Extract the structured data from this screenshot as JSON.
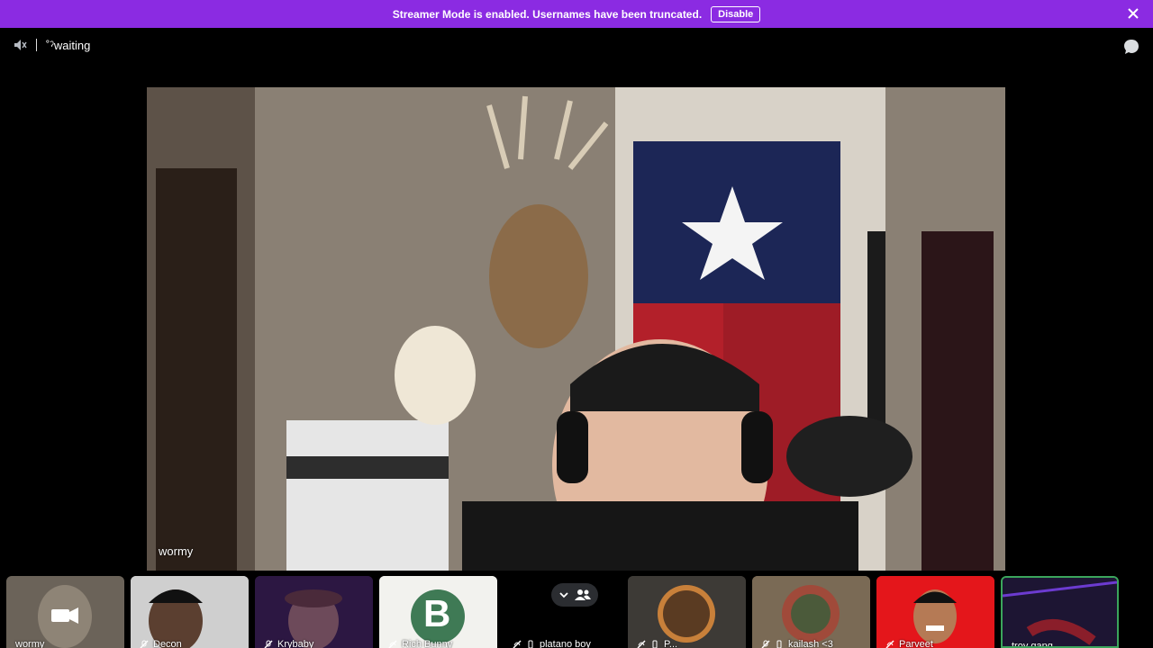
{
  "notice": {
    "text": "Streamer Mode is enabled. Usernames have been truncated.",
    "disable_label": "Disable"
  },
  "header": {
    "channel_name": "˚ˀwaiting"
  },
  "main_video": {
    "speaker_name": "wormy"
  },
  "tiles": [
    {
      "name": "wormy"
    },
    {
      "name": "Decon"
    },
    {
      "name": "Krybaby"
    },
    {
      "name": "Rich Bunny",
      "avatar_letter": "B"
    },
    {
      "name": "platano boy"
    },
    {
      "name": "P..."
    },
    {
      "name": "kailash <3"
    },
    {
      "name": "Parveet"
    },
    {
      "name": "troy gang"
    }
  ],
  "colors": {
    "notice_bg": "#8b2be2",
    "speaking_border": "#3ba55c"
  }
}
